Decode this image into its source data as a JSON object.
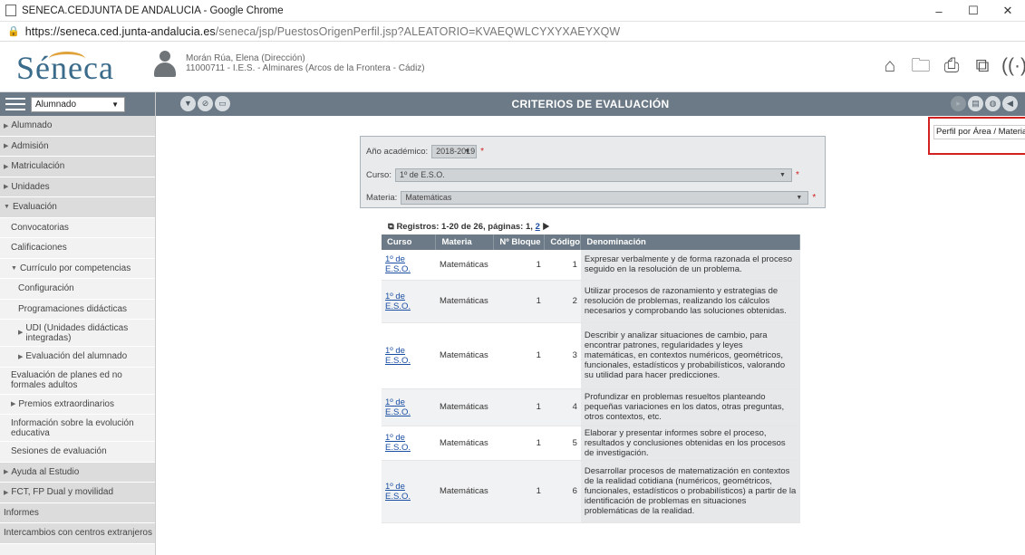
{
  "window": {
    "title": "SENECA.CEDJUNTA DE ANDALUCIA - Google Chrome",
    "minimize": "–",
    "maximize": "☐",
    "close": "✕"
  },
  "address": {
    "host": "https://seneca.ced.junta-andalucia.es",
    "path": "/seneca/jsp/PuestosOrigenPerfil.jsp?ALEATORIO=KVAEQWLCYXYXAEYXQW"
  },
  "app": {
    "logo": "Séneca",
    "user_name": "Morán Rúa, Elena (Dirección)",
    "user_center": "11000711 - I.E.S. - Alminares (Arcos de la Frontera - Cádiz)"
  },
  "toolbar": {
    "module": "Alumnado",
    "page_title": "CRITERIOS DE EVALUACIÓN",
    "tooltip": "Perfil por Área / Materia"
  },
  "sidebar": {
    "items": [
      {
        "label": "Alumnado",
        "level": 1
      },
      {
        "label": "Admisión",
        "level": 1
      },
      {
        "label": "Matriculación",
        "level": 1
      },
      {
        "label": "Unidades",
        "level": 1
      },
      {
        "label": "Evaluación",
        "level": 1,
        "open": true
      },
      {
        "label": "Convocatorias",
        "level": 2
      },
      {
        "label": "Calificaciones",
        "level": 2
      },
      {
        "label": "Currículo por competencias",
        "level": 2,
        "open": true
      },
      {
        "label": "Configuración",
        "level": 3
      },
      {
        "label": "Programaciones didácticas",
        "level": 3
      },
      {
        "label": "UDI (Unidades didácticas integradas)",
        "level": 3
      },
      {
        "label": "Evaluación del alumnado",
        "level": 3
      },
      {
        "label": "Evaluación de planes ed no formales adultos",
        "level": 2
      },
      {
        "label": "Premios extraordinarios",
        "level": 2
      },
      {
        "label": "Información sobre la evolución educativa",
        "level": 2
      },
      {
        "label": "Sesiones de evaluación",
        "level": 2
      },
      {
        "label": "Ayuda al Estudio",
        "level": 1
      },
      {
        "label": "FCT, FP Dual y movilidad",
        "level": 1
      },
      {
        "label": "Informes",
        "level": 1
      },
      {
        "label": "Intercambios con centros extranjeros",
        "level": 1
      }
    ]
  },
  "filters": {
    "anio_label": "Año académico:",
    "anio_value": "2018-2019",
    "curso_label": "Curso:",
    "curso_value": "1º de E.S.O.",
    "materia_label": "Materia:",
    "materia_value": "Matemáticas",
    "required": "*"
  },
  "records": {
    "summary": "Registros: 1-20 de 26, páginas: 1,",
    "page2": "2",
    "next": "▶"
  },
  "table": {
    "headers": [
      "Curso",
      "Materia",
      "Nº Bloque",
      "Código",
      "Denominación"
    ],
    "rows": [
      {
        "curso": "1º de E.S.O.",
        "materia": "Matemáticas",
        "bloque": "1",
        "codigo": "1",
        "den": "Expresar verbalmente y de forma razonada el proceso seguido en la resolución de un problema."
      },
      {
        "curso": "1º de E.S.O.",
        "materia": "Matemáticas",
        "bloque": "1",
        "codigo": "2",
        "den": "Utilizar procesos de razonamiento y estrategias de resolución de problemas, realizando los cálculos necesarios y comprobando las soluciones obtenidas."
      },
      {
        "curso": "1º de E.S.O.",
        "materia": "Matemáticas",
        "bloque": "1",
        "codigo": "3",
        "den": "Describir y analizar situaciones de cambio, para encontrar patrones, regularidades y leyes matemáticas, en contextos numéricos, geométricos, funcionales, estadísticos y probabilísticos, valorando su utilidad para hacer predicciones."
      },
      {
        "curso": "1º de E.S.O.",
        "materia": "Matemáticas",
        "bloque": "1",
        "codigo": "4",
        "den": "Profundizar en problemas resueltos planteando pequeñas variaciones en los datos, otras preguntas, otros contextos, etc."
      },
      {
        "curso": "1º de E.S.O.",
        "materia": "Matemáticas",
        "bloque": "1",
        "codigo": "5",
        "den": "Elaborar y presentar informes sobre el proceso, resultados y conclusiones obtenidas en los procesos de investigación."
      },
      {
        "curso": "1º de E.S.O.",
        "materia": "Matemáticas",
        "bloque": "1",
        "codigo": "6",
        "den": "Desarrollar procesos de matematización en contextos de la realidad cotidiana (numéricos, geométricos, funcionales, estadísticos o probabilísticos) a partir de la identificación de problemas en situaciones problemáticas de la realidad."
      }
    ]
  }
}
